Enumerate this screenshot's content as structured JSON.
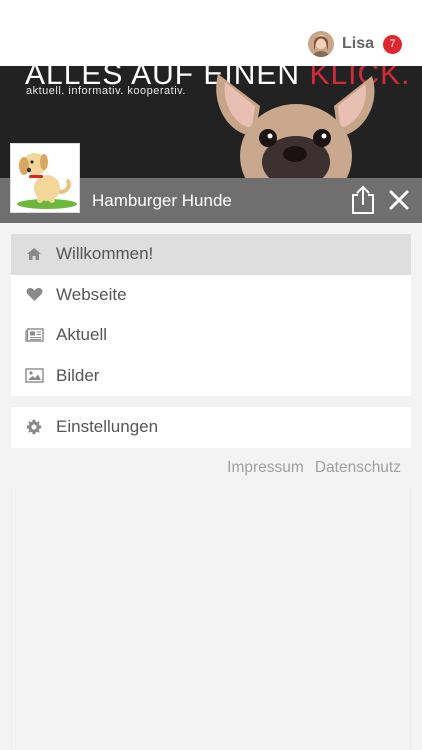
{
  "user": {
    "name": "Lisa",
    "notifications": "7"
  },
  "banner": {
    "headline_main": "ALLES AUF EINEN ",
    "headline_accent": "KLICK.",
    "tagline": "aktuell. informativ. kooperativ."
  },
  "group": {
    "title": "Hamburger Hunde"
  },
  "menu": {
    "items": [
      {
        "label": "Willkommen!",
        "icon": "home-icon",
        "active": true
      },
      {
        "label": "Webseite",
        "icon": "heart-icon"
      },
      {
        "label": "Aktuell",
        "icon": "newspaper-icon"
      },
      {
        "label": "Bilder",
        "icon": "image-icon"
      }
    ],
    "settings": {
      "label": "Einstellungen",
      "icon": "gear-icon"
    }
  },
  "footer": {
    "impressum": "Impressum",
    "datenschutz": "Datenschutz"
  },
  "colors": {
    "badge": "#e0262e",
    "accent": "#d12b3a",
    "titlebar": "#6f6f6f"
  }
}
